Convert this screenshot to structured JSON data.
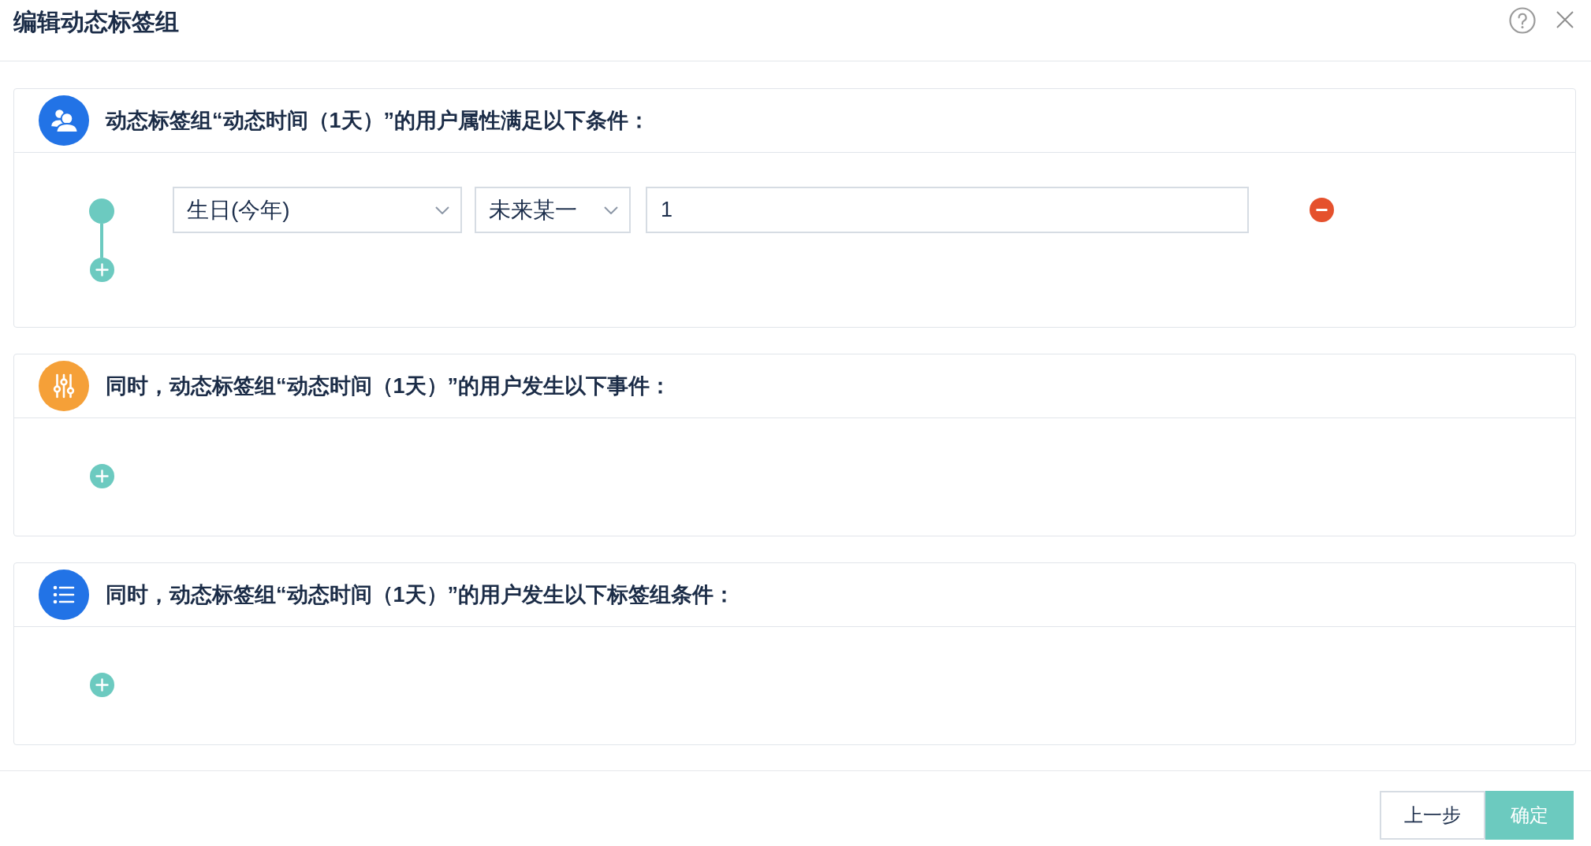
{
  "dialog": {
    "title": "编辑动态标签组"
  },
  "sections": [
    {
      "kind": "attributes",
      "title": "动态标签组“动态时间（1天）”的用户属性满足以下条件：",
      "conditions": [
        {
          "field": "生日(今年)",
          "operator": "未来某一",
          "value": "1"
        }
      ]
    },
    {
      "kind": "events",
      "title": "同时，动态标签组“动态时间（1天）”的用户发生以下事件："
    },
    {
      "kind": "tag_groups",
      "title": "同时，动态标签组“动态时间（1天）”的用户发生以下标签组条件："
    }
  ],
  "footer": {
    "buttons": [
      {
        "label": "上一步",
        "kind": "secondary"
      },
      {
        "label": "确定",
        "kind": "primary"
      }
    ]
  }
}
